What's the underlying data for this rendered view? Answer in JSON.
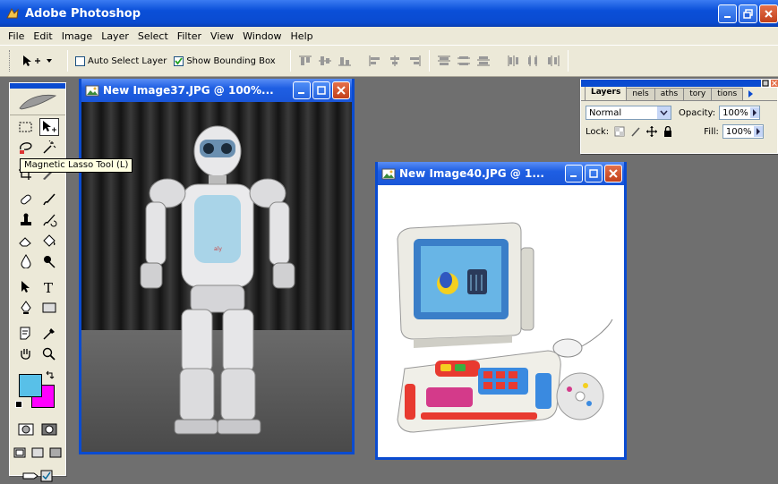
{
  "window": {
    "title": "Adobe Photoshop"
  },
  "menu": [
    "File",
    "Edit",
    "Image",
    "Layer",
    "Select",
    "Filter",
    "View",
    "Window",
    "Help"
  ],
  "options": {
    "auto_select_label": "Auto Select Layer",
    "auto_select_checked": false,
    "bounding_box_label": "Show Bounding Box",
    "bounding_box_checked": true
  },
  "toolbox": {
    "tooltip": "Magnetic Lasso Tool (L)",
    "foreground_color": "#58c0e8",
    "background_color": "#ff00ff"
  },
  "documents": [
    {
      "title": "New Image37.JPG @ 100%...",
      "content": "robot photo"
    },
    {
      "title": "New Image40.JPG @ 1...",
      "content": "toy computer photo"
    }
  ],
  "layers_panel": {
    "tabs": [
      "Layers",
      "nels",
      "aths",
      "tory",
      "tions"
    ],
    "blend_mode": "Normal",
    "opacity_label": "Opacity:",
    "opacity_value": "100%",
    "lock_label": "Lock:",
    "fill_label": "Fill:",
    "fill_value": "100%"
  }
}
